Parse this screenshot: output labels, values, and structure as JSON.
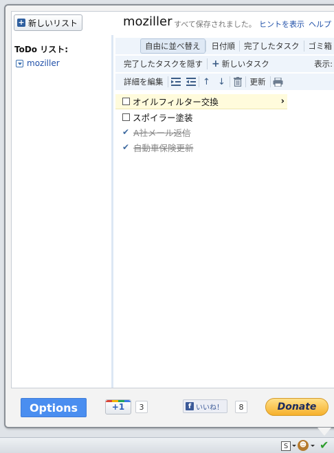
{
  "header": {
    "new_list_label": "新しいリスト",
    "list_title": "moziller",
    "save_status": "すべて保存されました。",
    "hint_link": "ヒントを表示",
    "help_link": "ヘルプ"
  },
  "sidebar": {
    "heading": "ToDo リスト:",
    "items": [
      {
        "label": "moziller"
      }
    ]
  },
  "toolbar": {
    "sort_free": "自由に並べ替え",
    "sort_date": "日付順",
    "completed_tasks": "完了したタスク",
    "trash": "ゴミ箱",
    "hide_completed": "完了したタスクを隠す",
    "new_task": "新しいタスク",
    "show_label": "表示:",
    "edit_details": "詳細を編集",
    "refresh": "更新"
  },
  "tasks": [
    {
      "text": "オイルフィルター交換",
      "done": false,
      "selected": true
    },
    {
      "text": "スポイラー塗装",
      "done": false,
      "selected": false
    },
    {
      "text": "A社メール返信",
      "done": true,
      "selected": false
    },
    {
      "text": "自動車保険更新",
      "done": true,
      "selected": false
    }
  ],
  "footer": {
    "options_label": "Options",
    "gplus_label": "+1",
    "gplus_count": "3",
    "like_label": "いいね！",
    "like_count": "8",
    "donate_label": "Donate"
  },
  "statusbar": {
    "s_icon_label": "S"
  },
  "colors": {
    "accent_blue": "#4a8ef0",
    "link_blue": "#1f4fa8",
    "toolbar_bg": "#eef4fb",
    "selected_row_bg": "#fffbdc"
  },
  "icons": [
    "plus-square-icon",
    "dropdown-icon",
    "indent-icon",
    "outdent-icon",
    "arrow-up-icon",
    "arrow-down-icon",
    "trash-icon",
    "print-icon",
    "chevron-right-icon",
    "checkmark-icon",
    "greasemonkey-icon"
  ]
}
